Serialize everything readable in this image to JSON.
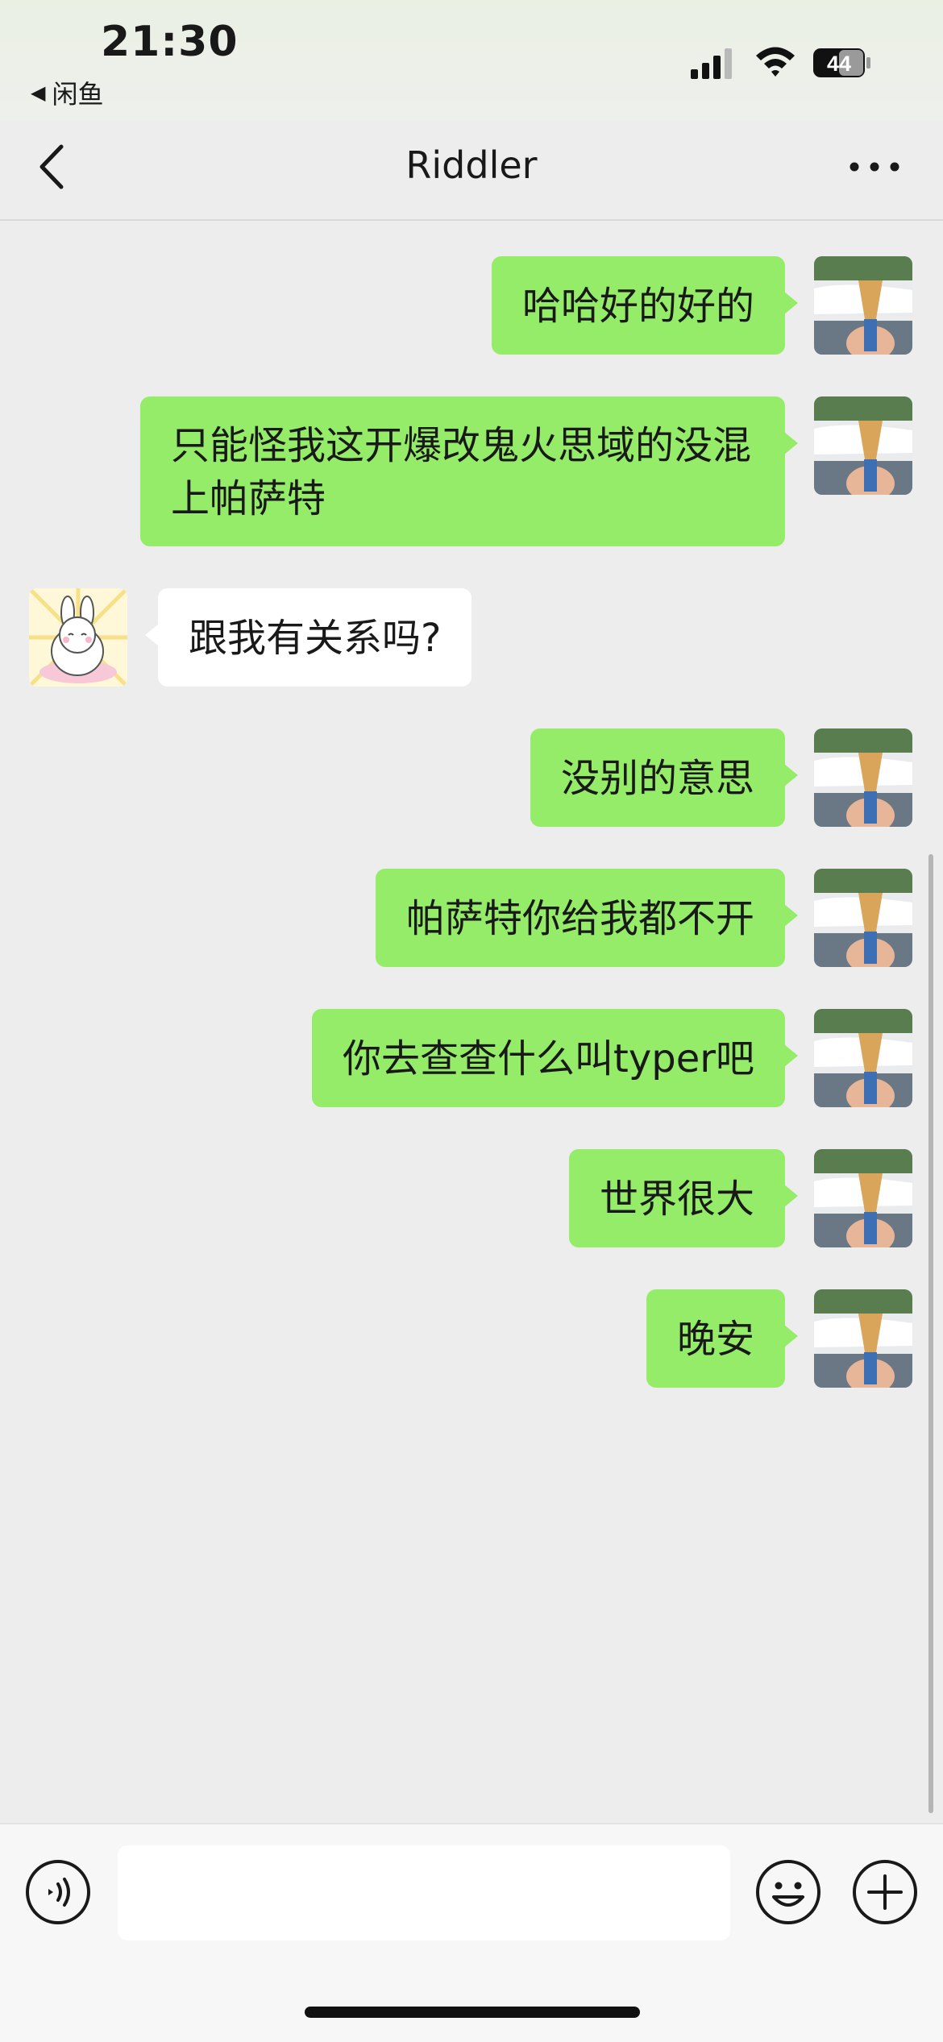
{
  "status_bar": {
    "time": "21:30",
    "back_app": "闲鱼",
    "battery": "44"
  },
  "nav": {
    "title": "Riddler"
  },
  "messages": [
    {
      "from": "me",
      "text": "哈哈好的好的"
    },
    {
      "from": "me",
      "text": "只能怪我这开爆改鬼火思域的没混上帕萨特"
    },
    {
      "from": "them",
      "text": "跟我有关系吗?"
    },
    {
      "from": "me",
      "text": "没别的意思"
    },
    {
      "from": "me",
      "text": "帕萨特你给我都不开"
    },
    {
      "from": "me",
      "text": "你去查查什么叫typer吧"
    },
    {
      "from": "me",
      "text": "世界很大"
    },
    {
      "from": "me",
      "text": "晚安"
    }
  ],
  "input": {
    "value": "",
    "placeholder": ""
  },
  "colors": {
    "my_bubble": "#95ec69",
    "their_bubble": "#ffffff",
    "background": "#ededed"
  },
  "icons": [
    "back-icon",
    "more-icon",
    "voice-icon",
    "emoji-icon",
    "plus-icon"
  ]
}
